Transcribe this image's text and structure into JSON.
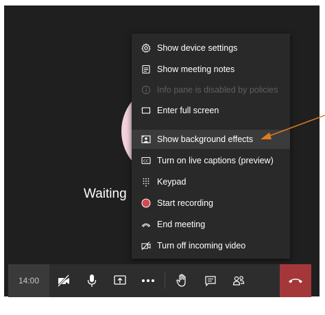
{
  "stage": {
    "waiting_text": "Waiting"
  },
  "menu": {
    "items": [
      {
        "label": "Show device settings",
        "icon": "gear-icon"
      },
      {
        "label": "Show meeting notes",
        "icon": "notes-icon"
      },
      {
        "label": "Info pane is disabled by policies",
        "icon": "info-icon",
        "disabled": true
      },
      {
        "label": "Enter full screen",
        "icon": "fullscreen-icon"
      },
      {
        "label": "Show background effects",
        "icon": "background-effects-icon",
        "highlighted": true
      },
      {
        "label": "Turn on live captions (preview)",
        "icon": "captions-icon"
      },
      {
        "label": "Keypad",
        "icon": "keypad-icon"
      },
      {
        "label": "Start recording",
        "icon": "record-icon"
      },
      {
        "label": "End meeting",
        "icon": "end-meeting-icon"
      },
      {
        "label": "Turn off incoming video",
        "icon": "video-off-icon"
      }
    ]
  },
  "toolbar": {
    "time": "14:00",
    "buttons": [
      "camera-off-icon",
      "microphone-icon",
      "share-screen-icon",
      "more-options-icon",
      "raise-hand-icon",
      "chat-icon",
      "participants-icon",
      "hang-up-icon"
    ]
  },
  "colors": {
    "stage_bg": "#1f1f1f",
    "menu_bg": "#292929",
    "hangup": "#a4373a",
    "record": "#d74654",
    "arrow": "#e07b22",
    "avatar": "#f2d3dc"
  }
}
